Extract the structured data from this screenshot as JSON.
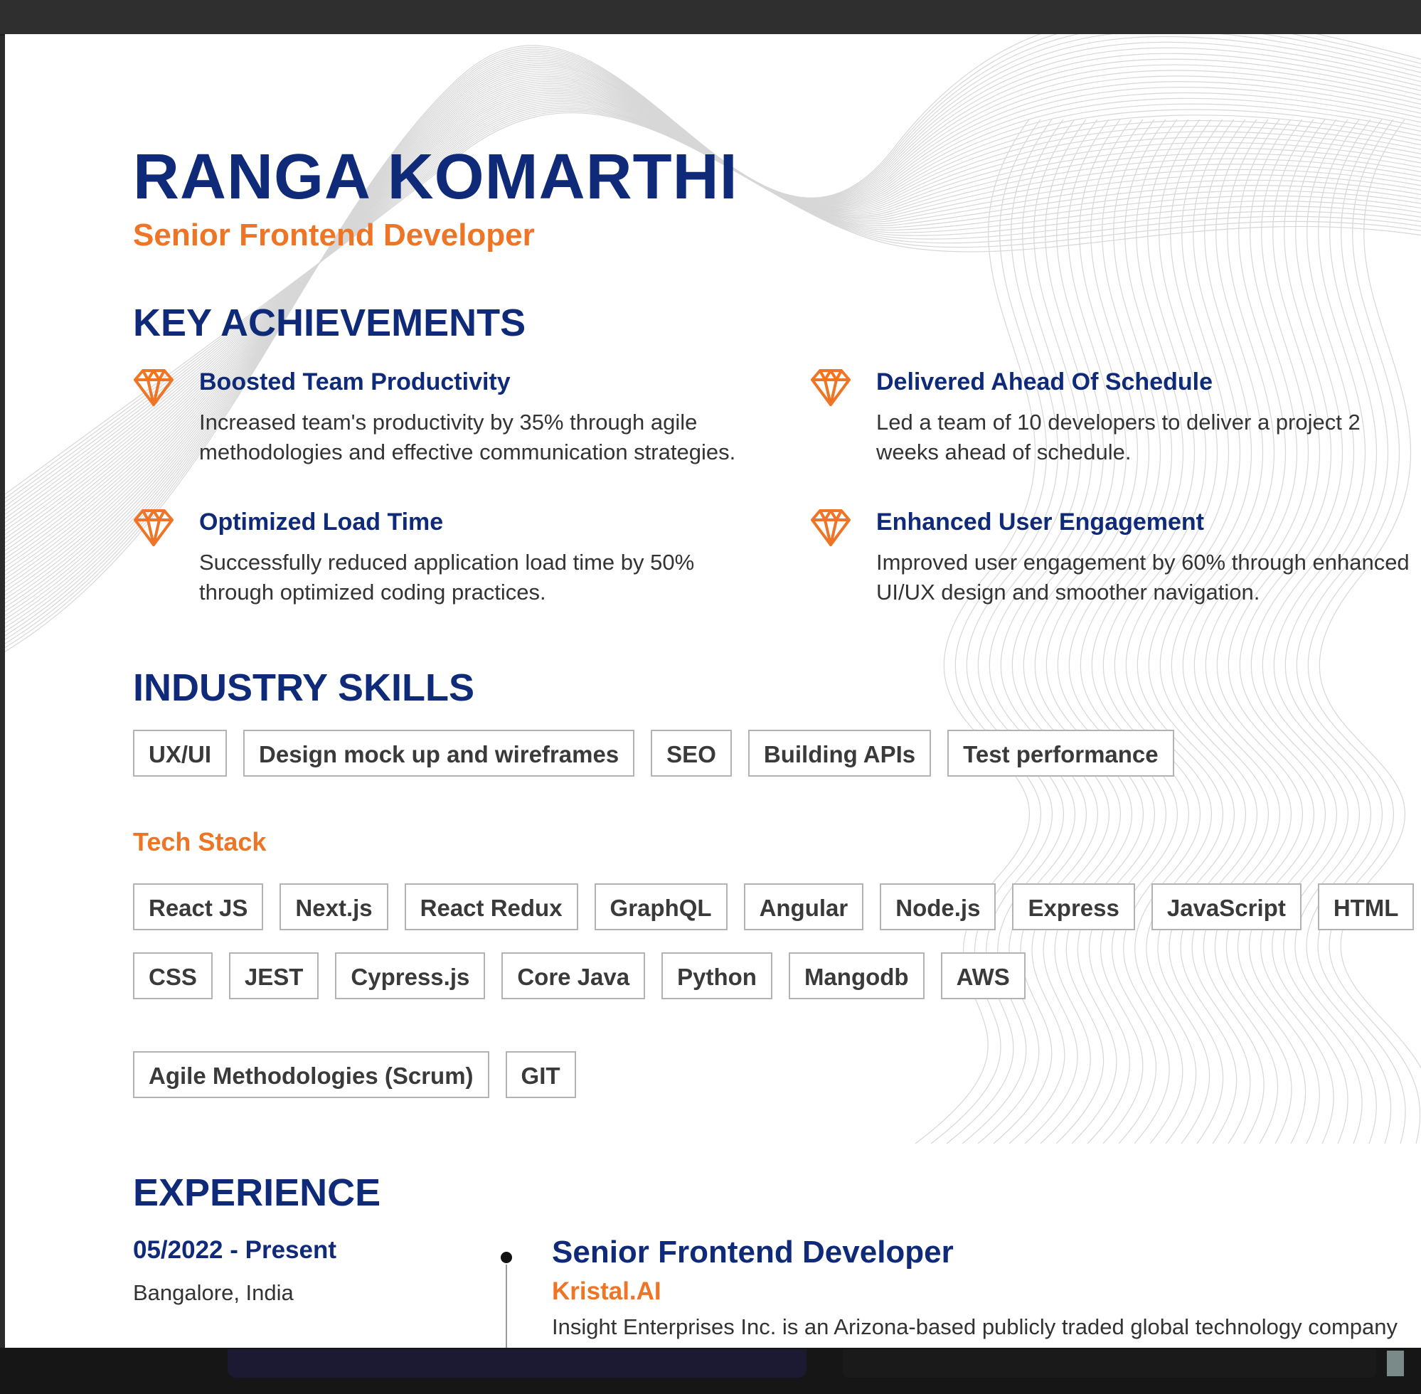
{
  "header": {
    "name": "RANGA KOMARTHI",
    "title": "Senior Frontend Developer"
  },
  "achievements": {
    "heading": "KEY ACHIEVEMENTS",
    "items": [
      {
        "title": "Boosted Team Productivity",
        "description": "Increased team's productivity by 35% through agile methodologies and effective communication strategies."
      },
      {
        "title": "Delivered Ahead Of Schedule",
        "description": "Led a team of 10 developers to deliver a project 2 weeks ahead of schedule."
      },
      {
        "title": "Optimized Load Time",
        "description": "Successfully reduced application load time by 50% through optimized coding practices."
      },
      {
        "title": "Enhanced User Engagement",
        "description": "Improved user engagement by 60% through enhanced UI/UX design and smoother navigation."
      }
    ],
    "icon": "diamond-icon"
  },
  "skills": {
    "heading": "INDUSTRY SKILLS",
    "industry": [
      "UX/UI",
      "Design mock up and wireframes",
      "SEO",
      "Building APIs",
      "Test performance"
    ],
    "tech_heading": "Tech Stack",
    "tech_row1": [
      "React JS",
      "Next.js",
      "React Redux",
      "GraphQL",
      "Angular",
      "Node.js",
      "Express",
      "JavaScript",
      "HTML"
    ],
    "tech_row2": [
      "CSS",
      "JEST",
      "Cypress.js",
      "Core Java",
      "Python",
      "Mangodb",
      "AWS"
    ],
    "tech_row3": [
      "Agile Methodologies (Scrum)",
      "GIT"
    ]
  },
  "experience": {
    "heading": "EXPERIENCE",
    "date": "05/2022 - Present",
    "location": "Bangalore, India",
    "role": "Senior Frontend Developer",
    "company": "Kristal.AI",
    "description": "Insight Enterprises Inc. is an Arizona-based publicly traded global technology company"
  },
  "colors": {
    "navy": "#0f2a78",
    "orange": "#ee7526",
    "text": "#333333",
    "tag_border": "#b3b3b3"
  }
}
